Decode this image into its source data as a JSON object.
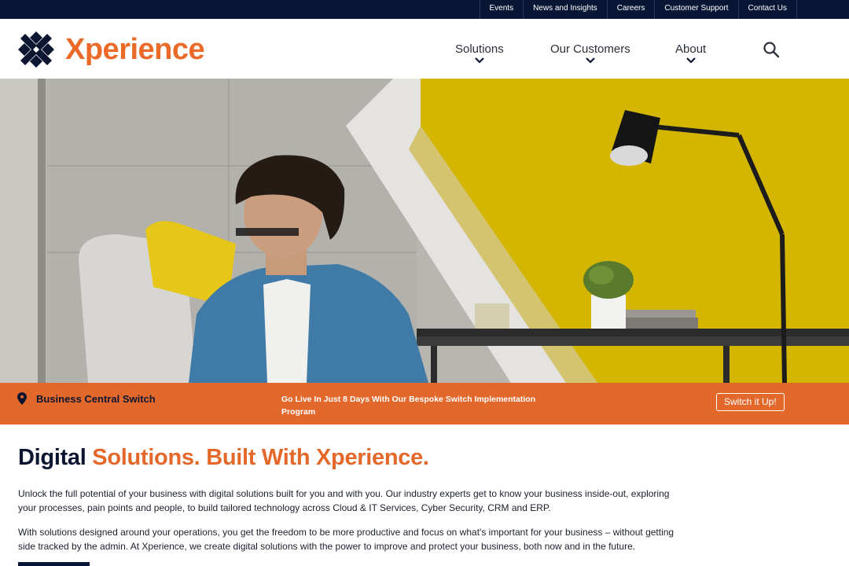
{
  "topbar": {
    "links": [
      "Events",
      "News and Insights",
      "Careers",
      "Customer Support",
      "Contact Us"
    ]
  },
  "header": {
    "logo_text": "Xperience",
    "nav": [
      {
        "label": "Solutions"
      },
      {
        "label": "Our Customers"
      },
      {
        "label": "About"
      }
    ],
    "search_icon": "search-icon"
  },
  "banner": {
    "title": "Business Central Switch",
    "text": "Go Live In Just 8 Days With Our Bespoke Switch Implementation Program",
    "button": "Switch it Up!",
    "icon": "location-pin-icon"
  },
  "content": {
    "headline_dark": "Digital",
    "headline_orange": "Solutions. Built With Xperience.",
    "paragraph_1": "Unlock the full potential of your business with digital solutions built for you and with you. Our industry experts get to know your business inside-out, exploring your processes, pain points and people, to build tailored technology across Cloud & IT Services, Cyber Security, CRM and ERP.",
    "paragraph_2": "With solutions designed around your operations, you get the freedom to be more productive and focus on what's important for your business – without getting side tracked by the admin. At Xperience, we create digital solutions with the power to improve and protect your business, both now and in the future."
  },
  "colors": {
    "navy": "#071634",
    "orange": "#e5682b",
    "banner_orange": "#e2682c",
    "yellow": "#d4b500"
  }
}
